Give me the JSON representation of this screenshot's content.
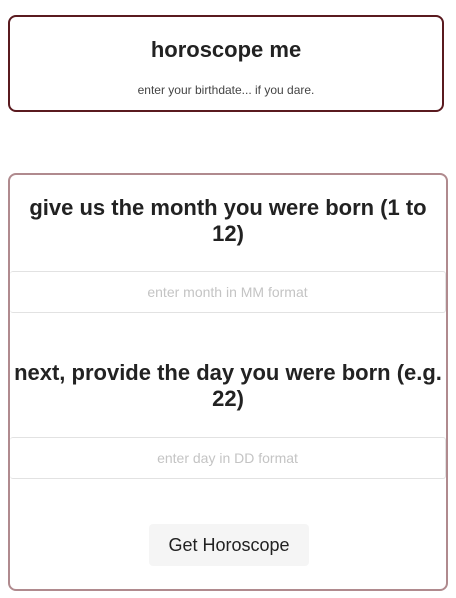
{
  "header": {
    "title": "horoscope me",
    "subtitle": "enter your birthdate... if you dare."
  },
  "form": {
    "month": {
      "question": "give us the month you were born (1 to 12)",
      "value": "",
      "placeholder": "enter month in MM format"
    },
    "day": {
      "question": "next, provide the day you were born (e.g. 22)",
      "value": "",
      "placeholder": "enter day in DD format"
    },
    "submit_label": "Get Horoscope"
  },
  "colors": {
    "header_border": "#5a1a1f",
    "form_border": "#b08a8e",
    "button_bg": "#f5f5f5"
  }
}
